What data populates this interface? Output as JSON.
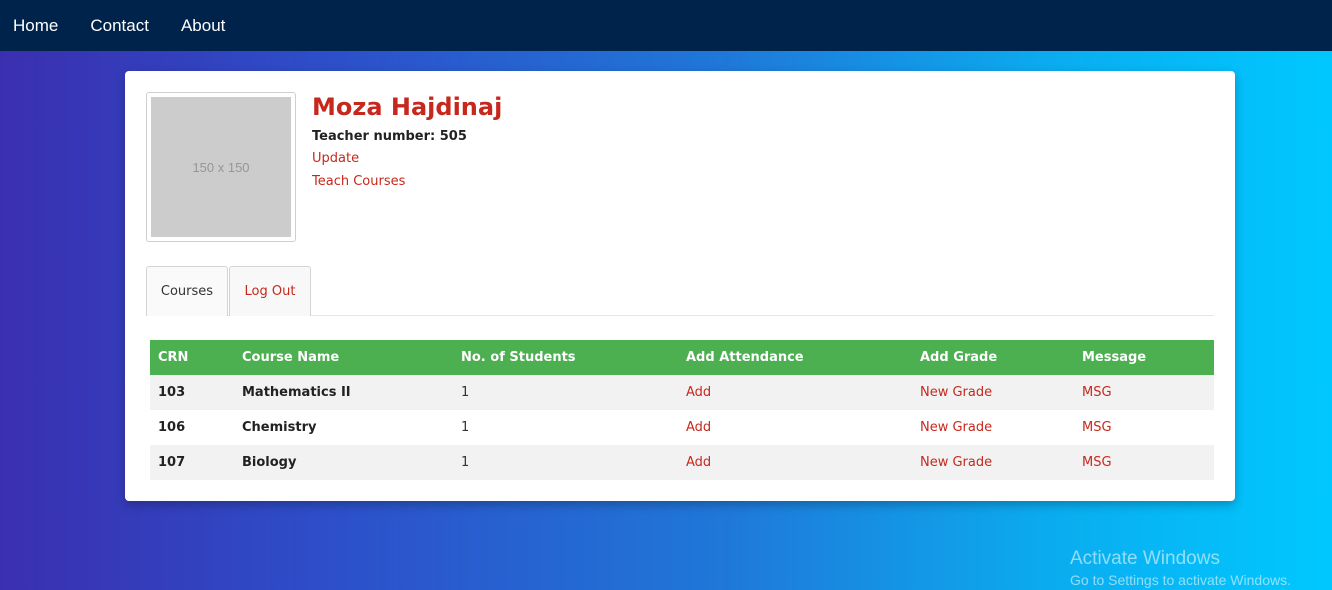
{
  "nav": {
    "items": [
      "Home",
      "Contact",
      "About"
    ]
  },
  "profile": {
    "image_placeholder": "150 x 150",
    "name": "Moza Hajdinaj",
    "teacher_number": "Teacher number: 505",
    "update_link": "Update",
    "teach_link": "Teach Courses"
  },
  "tabs": [
    "Courses",
    "Log Out"
  ],
  "table": {
    "headers": [
      "CRN",
      "Course Name",
      "No. of Students",
      "Add Attendance",
      "Add Grade",
      "Message"
    ],
    "rows": [
      {
        "crn": "103",
        "course": "Mathematics II",
        "students": "1",
        "attendance": "Add",
        "grade": "New Grade",
        "message": "MSG"
      },
      {
        "crn": "106",
        "course": "Chemistry",
        "students": "1",
        "attendance": "Add",
        "grade": "New Grade",
        "message": "MSG"
      },
      {
        "crn": "107",
        "course": "Biology",
        "students": "1",
        "attendance": "Add",
        "grade": "New Grade",
        "message": "MSG"
      }
    ]
  },
  "watermark": {
    "title": "Activate Windows",
    "subtitle": "Go to Settings to activate Windows."
  },
  "colors": {
    "navbar": "#00234b",
    "accent_red": "#c7281d",
    "table_header": "#4caf50"
  }
}
